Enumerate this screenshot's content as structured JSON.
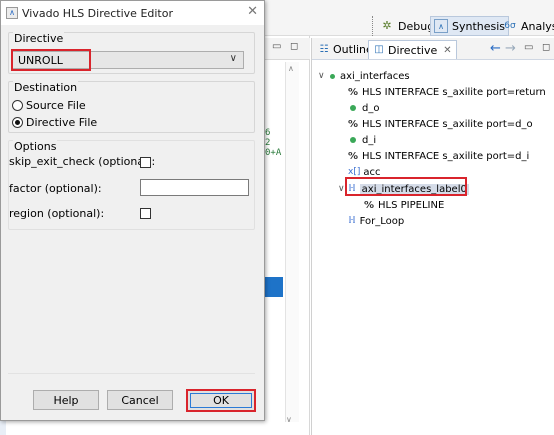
{
  "dialog": {
    "title": "Vivado HLS Directive Editor",
    "close_glyph": "✕",
    "directive_group": "Directive",
    "directive_value": "UNROLL",
    "destination_group": "Destination",
    "radio_source": "Source File",
    "radio_directive": "Directive File",
    "options_group": "Options",
    "opt_skip": "skip_exit_check (optional):",
    "opt_factor": "factor (optional):",
    "opt_region": "region (optional):",
    "factor_value": "",
    "btn_help": "Help",
    "btn_cancel": "Cancel",
    "btn_ok": "OK"
  },
  "perspectives": {
    "debug": "Debug",
    "synthesis": "Synthesis",
    "analysis": "Analysis"
  },
  "view": {
    "tab_outline": "Outline",
    "tab_directive": "Directive",
    "tab_close": "✕"
  },
  "tree": [
    {
      "text": "axi_interfaces"
    },
    {
      "text": "HLS INTERFACE s_axilite port=return"
    },
    {
      "text": "d_o"
    },
    {
      "text": "HLS INTERFACE s_axilite port=d_o"
    },
    {
      "text": "d_i"
    },
    {
      "text": "HLS INTERFACE s_axilite port=d_i"
    },
    {
      "text": "acc"
    },
    {
      "text": "axi_interfaces_label0"
    },
    {
      "text": "HLS PIPELINE"
    },
    {
      "text": "For_Loop"
    }
  ],
  "code_fragments": [
    "6",
    "2",
    "0+A"
  ],
  "colors": {
    "highlight_red": "#d9242c",
    "accent_blue": "#1e73c8",
    "port_green": "#3aa858"
  }
}
